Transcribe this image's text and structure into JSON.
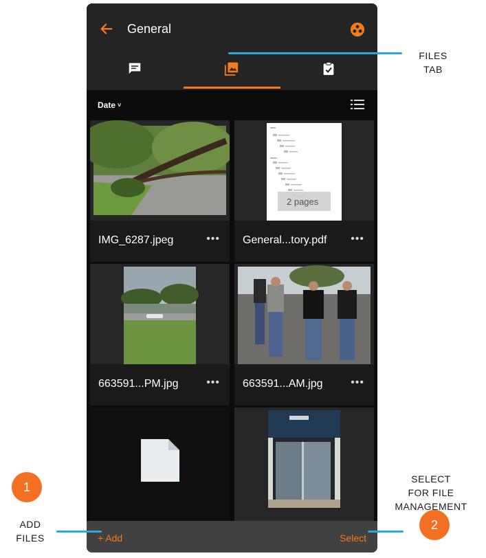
{
  "header": {
    "title": "General",
    "back_icon": "arrow-left-icon",
    "team_icon": "team-circle-icon",
    "accent_color": "#f47a20"
  },
  "tabs": [
    {
      "id": "chat",
      "icon": "chat-icon",
      "active": false
    },
    {
      "id": "files",
      "icon": "image-gallery-icon",
      "active": true
    },
    {
      "id": "tasks",
      "icon": "clipboard-check-icon",
      "active": false
    }
  ],
  "sort": {
    "label": "Date",
    "chevron": "❯",
    "view_icon": "list-view-icon"
  },
  "files": [
    {
      "name": "IMG_6287.jpeg",
      "more": "•••",
      "kind": "photo"
    },
    {
      "name": "General...tory.pdf",
      "more": "•••",
      "kind": "pdf",
      "page_badge": "2 pages"
    },
    {
      "name": "663591...PM.jpg",
      "more": "•••",
      "kind": "photo"
    },
    {
      "name": "663591...AM.jpg",
      "more": "•••",
      "kind": "photo"
    },
    {
      "name": "",
      "more": "",
      "kind": "document"
    },
    {
      "name": "",
      "more": "",
      "kind": "photo"
    }
  ],
  "bottombar": {
    "add_label": "+ Add",
    "select_label": "Select"
  },
  "callouts": {
    "files_tab": [
      "FILES",
      "TAB"
    ],
    "add_files": [
      "ADD",
      "FILES"
    ],
    "select": [
      "SELECT",
      "FOR FILE",
      "MANAGEMENT"
    ],
    "badge_1": "1",
    "badge_2": "2",
    "line_color": "#29a9e0",
    "badge_color": "#f36f21"
  }
}
